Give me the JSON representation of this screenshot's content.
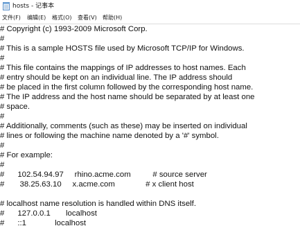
{
  "window": {
    "title": "hosts - 记事本"
  },
  "menu": {
    "items": [
      {
        "label": "文件(F)"
      },
      {
        "label": "编辑(E)"
      },
      {
        "label": "格式(O)"
      },
      {
        "label": "查看(V)"
      },
      {
        "label": "帮助(H)"
      }
    ]
  },
  "editor": {
    "lines": [
      "# Copyright (c) 1993-2009 Microsoft Corp.",
      "#",
      "# This is a sample HOSTS file used by Microsoft TCP/IP for Windows.",
      "#",
      "# This file contains the mappings of IP addresses to host names. Each",
      "# entry should be kept on an individual line. The IP address should",
      "# be placed in the first column followed by the corresponding host name.",
      "# The IP address and the host name should be separated by at least one",
      "# space.",
      "#",
      "# Additionally, comments (such as these) may be inserted on individual",
      "# lines or following the machine name denoted by a '#' symbol.",
      "#",
      "# For example:",
      "#",
      "#      102.54.94.97     rhino.acme.com          # source server",
      "#       38.25.63.10     x.acme.com              # x client host",
      "",
      "# localhost name resolution is handled within DNS itself.",
      "#\t127.0.0.1       localhost",
      "#\t::1             localhost"
    ]
  }
}
